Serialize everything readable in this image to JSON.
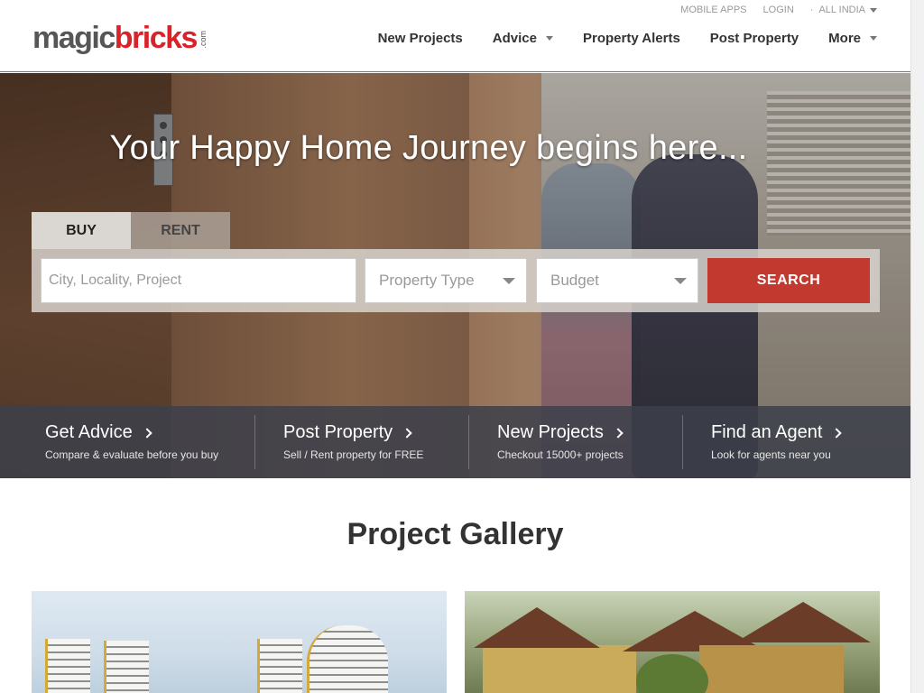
{
  "header": {
    "logo": {
      "magic": "magic",
      "bricks": "bricks",
      "suffix": ".com"
    },
    "top_links": {
      "mobile_apps": "MOBILE APPS",
      "login": "LOGIN",
      "region": "ALL INDIA"
    },
    "nav": {
      "new_projects": "New Projects",
      "advice": "Advice",
      "property_alerts": "Property Alerts",
      "post_property": "Post Property",
      "more": "More"
    }
  },
  "hero": {
    "title": "Your Happy Home Journey begins here...",
    "tabs": {
      "buy": "BUY",
      "rent": "RENT"
    },
    "search": {
      "placeholder": "City, Locality, Project",
      "property_type": "Property Type",
      "budget": "Budget",
      "button": "SEARCH"
    }
  },
  "quick_links": [
    {
      "title": "Get Advice",
      "subtitle": "Compare & evaluate before you buy"
    },
    {
      "title": "Post Property",
      "subtitle": "Sell / Rent property for FREE"
    },
    {
      "title": "New Projects",
      "subtitle": "Checkout 15000+ projects"
    },
    {
      "title": "Find an Agent",
      "subtitle": "Look for agents near you"
    }
  ],
  "gallery": {
    "title": "Project Gallery"
  },
  "colors": {
    "brand_red": "#d8232a",
    "search_button": "#c23a2f",
    "logo_gray": "#565656",
    "quick_bar": "#3c404a"
  },
  "icons": {
    "dropdown": "chevron-down-icon",
    "arrow": "chevron-right-icon"
  }
}
